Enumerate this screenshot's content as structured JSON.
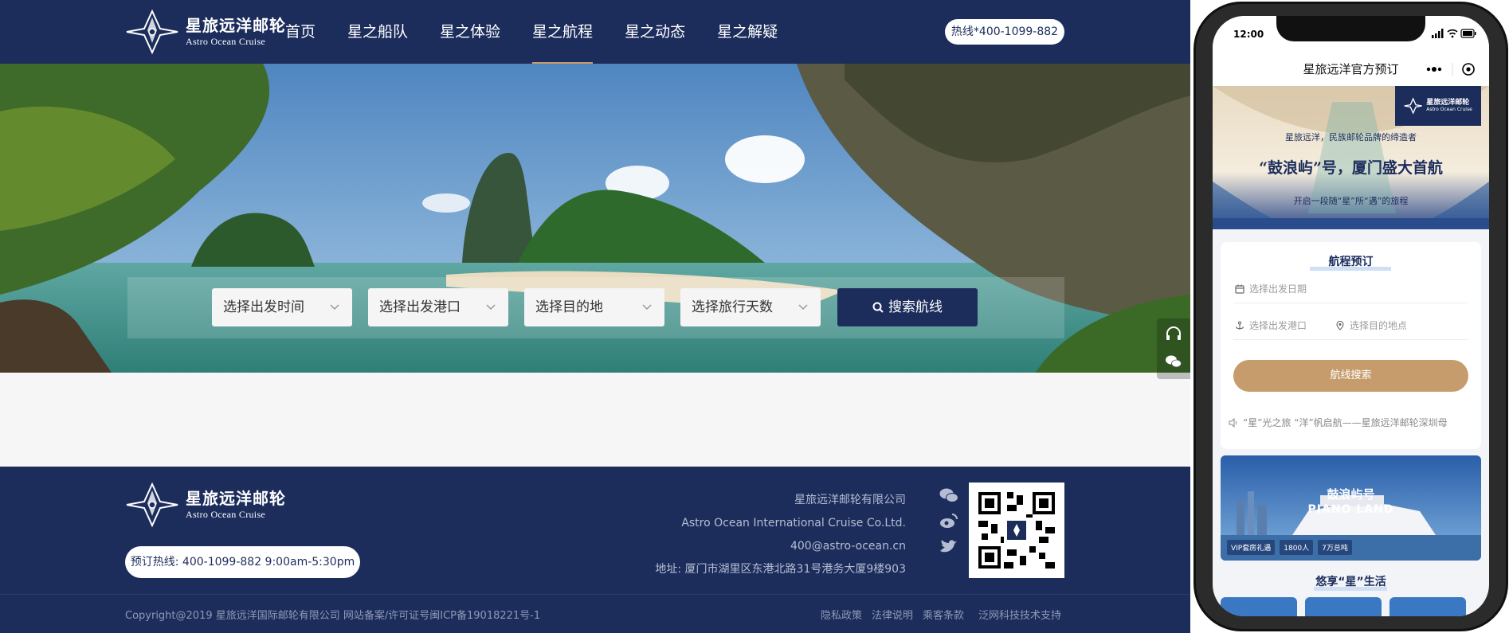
{
  "site": {
    "brand": {
      "cn": "星旅远洋邮轮",
      "en": "Astro Ocean Cruise"
    },
    "nav": [
      {
        "label": "首页"
      },
      {
        "label": "星之船队"
      },
      {
        "label": "星之体验"
      },
      {
        "label": "星之航程",
        "active": true
      },
      {
        "label": "星之动态"
      },
      {
        "label": "星之解疑"
      }
    ],
    "hotline": "热线*400-1099-882",
    "search": {
      "date": "选择出发时间",
      "port": "选择出发港口",
      "destination": "选择目的地",
      "days": "选择旅行天数",
      "button": "搜索航线"
    },
    "footer": {
      "hotline": "预订热线:  400-1099-882    9:00am-5:30pm",
      "company_cn": "星旅远洋邮轮有限公司",
      "company_en": "Astro Ocean International Cruise Co.Ltd.",
      "email": "400@astro-ocean.cn",
      "address": "地址: 厦门市湖里区东港北路31号港务大厦9楼903",
      "copyright": "Copyright@2019 星旅远洋国际邮轮有限公司 网站备案/许可证号闽ICP备19018221号-1",
      "links": [
        "隐私政策",
        "法律说明",
        "乘客条款",
        "泛网科技技术支持"
      ]
    }
  },
  "phone": {
    "time": "12:00",
    "title": "星旅远洋官方预订",
    "banner": {
      "logo_cn": "星旅远洋邮轮",
      "logo_en": "Astro Ocean Cruise",
      "tagline": "星旅远洋，民族邮轮品牌的缔造者",
      "title": "“鼓浪屿”号，厦门盛大首航",
      "subtitle": "开启一段随“星”所“遇”的旅程"
    },
    "booking": {
      "title": "航程预订",
      "date_placeholder": "选择出发日期",
      "port_placeholder": "选择出发港口",
      "dest_placeholder": "选择目的地点",
      "button": "航线搜索",
      "notice": "“星”光之旅 “洋”帆启航——星旅远洋邮轮深圳母"
    },
    "ship": {
      "name": "鼓浪屿号",
      "name_en": "PIANO LAND",
      "tags": [
        "VIP套房礼遇",
        "1800人",
        "7万总吨"
      ]
    },
    "life_title": "悠享“星”生活"
  },
  "colors": {
    "navy": "#1c2d5c",
    "gold": "#c69c6d"
  }
}
